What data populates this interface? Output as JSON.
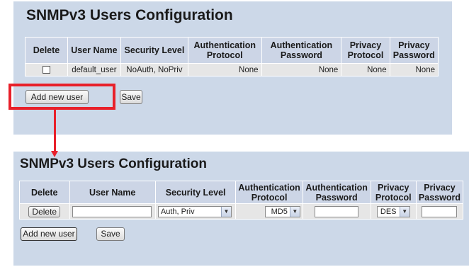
{
  "top": {
    "title": "SNMPv3 Users Configuration",
    "columns": [
      "Delete",
      "User Name",
      "Security Level",
      "Authentication Protocol",
      "Authentication Password",
      "Privacy Protocol",
      "Privacy Password"
    ],
    "row": {
      "user_name": "default_user",
      "security_level": "NoAuth, NoPriv",
      "auth_protocol": "None",
      "auth_password": "None",
      "privacy_protocol": "None",
      "privacy_password": "None"
    },
    "add_button": "Add new user",
    "save_button": "Save"
  },
  "bottom": {
    "title": "SNMPv3 Users Configuration",
    "columns": [
      "Delete",
      "User Name",
      "Security Level",
      "Authentication Protocol",
      "Authentication Password",
      "Privacy Protocol",
      "Privacy Password"
    ],
    "row": {
      "delete_button": "Delete",
      "user_name": "",
      "security_level": "Auth, Priv",
      "auth_protocol": "MD5",
      "auth_password": "",
      "privacy_protocol": "DES",
      "privacy_password": ""
    },
    "add_button": "Add new user",
    "save_button": "Save"
  },
  "colors": {
    "panel": "#ccd8e8",
    "header": "#ccd5e6",
    "cell": "#e6e6e6",
    "annotation": "#e8202a"
  }
}
